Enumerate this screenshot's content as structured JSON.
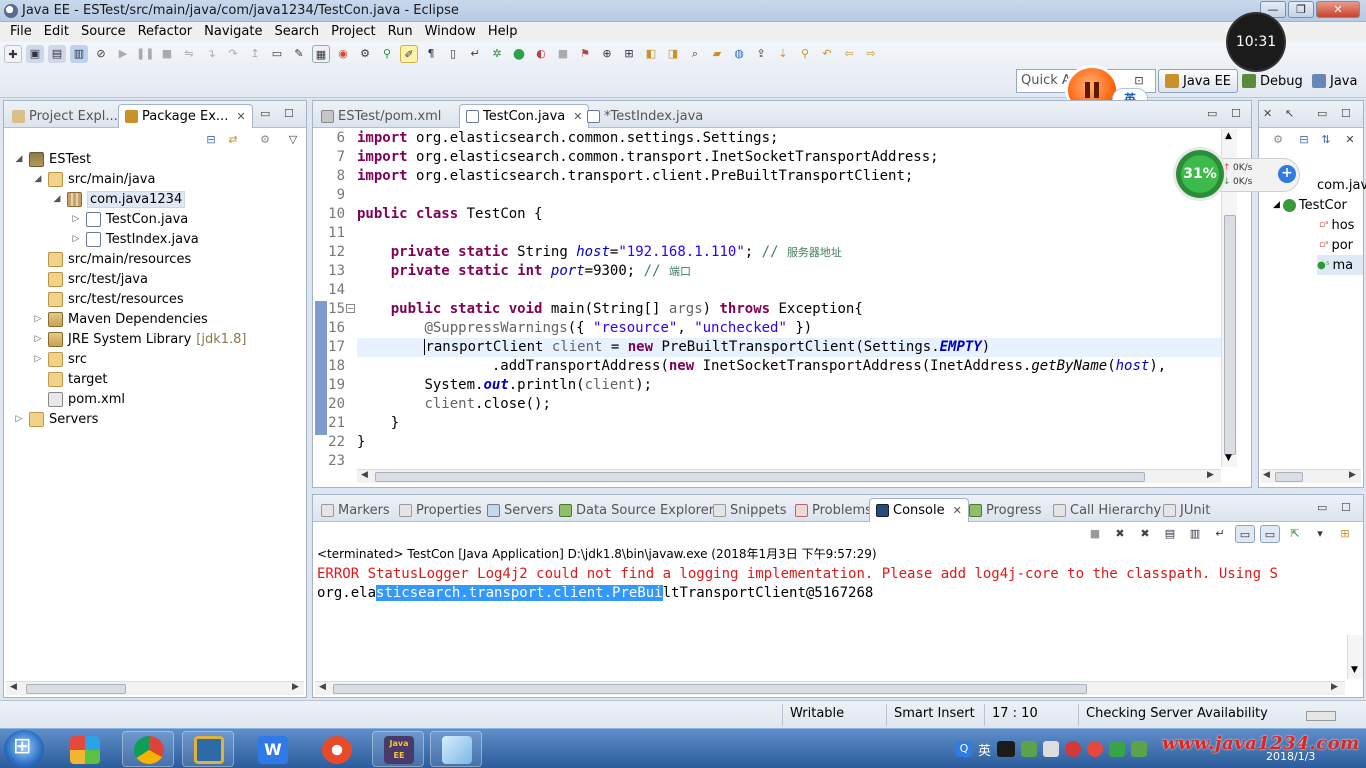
{
  "window": {
    "title": "Java EE - ESTest/src/main/java/com/java1234/TestCon.java - Eclipse",
    "minimize": "—",
    "maximize": "❐",
    "close": "✕"
  },
  "menu": [
    "File",
    "Edit",
    "Source",
    "Refactor",
    "Navigate",
    "Search",
    "Project",
    "Run",
    "Window",
    "Help"
  ],
  "toolbar": {
    "quick_access_placeholder": "Quick Ac",
    "perspectives": {
      "javaee": "Java EE",
      "debug": "Debug",
      "java": "Java"
    },
    "clock": "10:31",
    "ime_badge": "英"
  },
  "left_panel": {
    "tabs": [
      {
        "label": "Project Expl..."
      },
      {
        "label": "Package Ex..."
      }
    ],
    "tree": [
      {
        "label": "ESTest",
        "icon": "project-icon",
        "twisty": "◢"
      },
      {
        "label": "src/main/java",
        "icon": "source-folder-icon",
        "twisty": "◢"
      },
      {
        "label": "com.java1234",
        "icon": "package-icon",
        "twisty": "◢"
      },
      {
        "label": "TestCon.java",
        "icon": "java-file-icon",
        "twisty": "▷"
      },
      {
        "label": "TestIndex.java",
        "icon": "java-file-icon",
        "twisty": "▷"
      },
      {
        "label": "src/main/resources",
        "icon": "source-folder-icon",
        "twisty": ""
      },
      {
        "label": "src/test/java",
        "icon": "source-folder-icon",
        "twisty": ""
      },
      {
        "label": "src/test/resources",
        "icon": "source-folder-icon",
        "twisty": ""
      },
      {
        "label": "Maven Dependencies",
        "icon": "library-icon",
        "twisty": "▷"
      },
      {
        "label": "JRE System Library",
        "suffix": "[jdk1.8]",
        "icon": "library-icon",
        "twisty": "▷"
      },
      {
        "label": "src",
        "icon": "folder-icon",
        "twisty": "▷"
      },
      {
        "label": "target",
        "icon": "folder-icon",
        "twisty": ""
      },
      {
        "label": "pom.xml",
        "icon": "xml-file-icon",
        "twisty": ""
      },
      {
        "label": "Servers",
        "icon": "folder-icon",
        "twisty": "▷"
      }
    ]
  },
  "editor": {
    "tabs": [
      {
        "label": "ESTest/pom.xml"
      },
      {
        "label": "TestCon.java"
      },
      {
        "label": "*TestIndex.java"
      }
    ],
    "line_numbers": [
      "6",
      "7",
      "8",
      "9",
      "10",
      "11",
      "12",
      "13",
      "14",
      "15",
      "16",
      "17",
      "18",
      "19",
      "20",
      "21",
      "22",
      "23"
    ],
    "lines": {
      "l6": {
        "kw": "import",
        "rest": " org.elasticsearch.common.settings.Settings;"
      },
      "l7": {
        "kw": "import",
        "rest": " org.elasticsearch.common.transport.InetSocketTransportAddress;"
      },
      "l8": {
        "kw": "import",
        "rest": " org.elasticsearch.transport.client.PreBuiltTransportClient;"
      },
      "l10": {
        "kw1": "public",
        "kw2": "class",
        "rest": " TestCon {"
      },
      "l12": {
        "kw1": "private",
        "kw2": "static",
        "type": " String ",
        "field": "host",
        "eq": "=",
        "str": "\"192.168.1.110\"",
        "semi": "; ",
        "cmt": "// ",
        "cmt_cn": "服务器地址"
      },
      "l13": {
        "kw1": "private",
        "kw2": "static",
        "kw3": "int",
        "field": "port",
        "rest": "=9300; ",
        "cmt": "// ",
        "cmt_cn": "端口"
      },
      "l15": {
        "kw1": "public",
        "kw2": "static",
        "kw3": "void",
        "mid": " main(String[] ",
        "param": "args",
        "close": ") ",
        "kw4": "throws",
        "rest": " Exception{"
      },
      "l16": {
        "ann": "@SuppressWarnings",
        "open": "({ ",
        "s1": "\"resource\"",
        "comma": ", ",
        "s2": "\"unchecked\"",
        "close": " })"
      },
      "l17": {
        "type": "ransportClient ",
        "var": "client",
        "eq": " = ",
        "kw": "new",
        "mid": " PreBuiltTransportClient(Settings.",
        "sfld": "EMPTY",
        "close": ")"
      },
      "l18": {
        "pre": "        .addTransportAddress(",
        "kw": "new",
        "mid": " InetSocketTransportAddress(InetAddress.",
        "smeth": "getByName",
        "open": "(",
        "fld": "host",
        "close": "),"
      },
      "l19": {
        "pre": "System.",
        "sfld": "out",
        "rest": ".println(",
        "var": "client",
        "close": ");"
      },
      "l20": {
        "var": "client",
        "rest": ".close();"
      },
      "l21": {
        "rest": "}"
      },
      "l22": {
        "rest": "}"
      }
    }
  },
  "outline": {
    "items": [
      {
        "label": "com.jav"
      },
      {
        "label": "TestCor"
      },
      {
        "label": "hos"
      },
      {
        "label": "por"
      },
      {
        "label": "ma"
      }
    ]
  },
  "net_widget": {
    "percent": "31%",
    "up": "0K/s",
    "down": "0K/s",
    "plus": "+"
  },
  "console": {
    "tabs": [
      {
        "label": "Markers"
      },
      {
        "label": "Properties"
      },
      {
        "label": "Servers"
      },
      {
        "label": "Data Source Explorer"
      },
      {
        "label": "Snippets"
      },
      {
        "label": "Problems"
      },
      {
        "label": "Console"
      },
      {
        "label": "Progress"
      },
      {
        "label": "Call Hierarchy"
      },
      {
        "label": "JUnit"
      }
    ],
    "description": "<terminated> TestCon [Java Application] D:\\jdk1.8\\bin\\javaw.exe (2018年1月3日 下午9:57:29)",
    "error_line": "ERROR StatusLogger Log4j2 could not find a logging implementation. Please add log4j-core to the classpath. Using S",
    "out_pre": "org.ela",
    "out_sel": "sticsearch.transport.client.PreBui",
    "out_post": "ltTransportClient@5167268"
  },
  "status": {
    "writable": "Writable",
    "insert_mode": "Smart Insert",
    "position": "17 : 10",
    "task": "Checking Server Availability"
  },
  "taskbar": {
    "apps": [
      {
        "name": "chrome"
      },
      {
        "name": "explorer"
      },
      {
        "name": "wps"
      },
      {
        "name": "browser"
      },
      {
        "name": "eclipse",
        "label": "Java EE"
      },
      {
        "name": "notepad"
      }
    ],
    "ime": "英",
    "watermark": "www.java1234.com",
    "date": "2018/1/3"
  },
  "colors": {
    "keyword": "#7f0055",
    "string": "#2a00ff",
    "comment": "#3f7f5f",
    "field": "#0000c0",
    "error": "#e01818",
    "selection": "#3399ff"
  }
}
